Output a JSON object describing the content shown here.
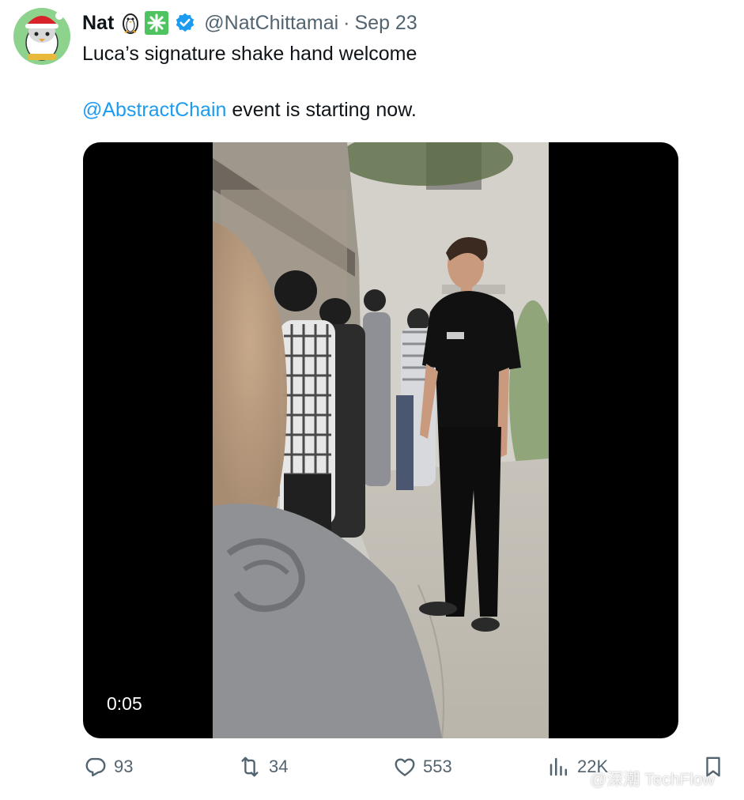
{
  "author": {
    "name": "Nat",
    "handle": "@NatChittamai",
    "separator": "·",
    "date": "Sep 23"
  },
  "tweet": {
    "line1": "Luca’s signature shake hand welcome",
    "mention": "@AbstractChain",
    "line2_rest": " event is starting now."
  },
  "video": {
    "duration": "0:05"
  },
  "actions": {
    "replies": "93",
    "retweets": "34",
    "likes": "553",
    "views": "22K"
  },
  "watermark": {
    "text": "@深潮 TechFlow"
  },
  "colors": {
    "accent": "#1d9bf0",
    "secondary_text": "#536471",
    "verified": "#1d9bf0"
  },
  "icons": [
    "penguin-icon",
    "sparkle-icon",
    "verified-badge-icon",
    "reply-icon",
    "retweet-icon",
    "like-icon",
    "views-icon",
    "bookmark-icon"
  ]
}
